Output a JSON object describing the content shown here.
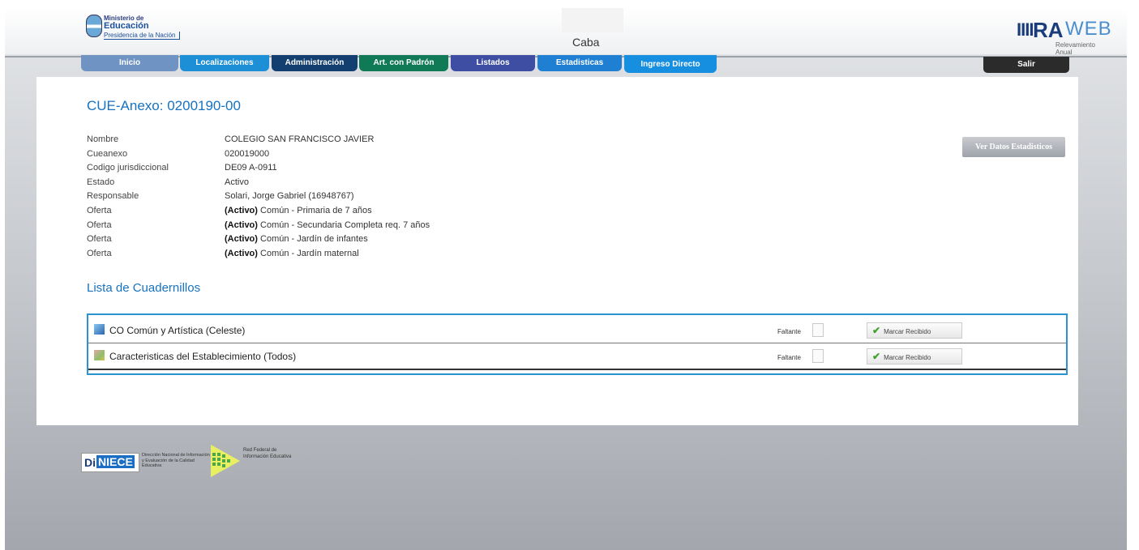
{
  "header": {
    "ministerio_l1": "Ministerio de",
    "ministerio_l2": "Educación",
    "ministerio_l3": "Presidencia de la Nación",
    "province": "Caba",
    "brand_bars": "IIII",
    "brand_ra": "RA",
    "brand_web": "WEB",
    "brand_sub": "Relevamiento Anual"
  },
  "nav": {
    "tabs": [
      "Inicio",
      "Localizaciones",
      "Administración",
      "Art. con Padrón",
      "Listados",
      "Estadisticas",
      "Ingreso Directo"
    ],
    "salir": "Salir"
  },
  "main": {
    "cue_title": "CUE-Anexo: 0200190-00",
    "ver_button": "Ver Datos Estadisticos",
    "info": [
      {
        "label": "Nombre",
        "prefix": "",
        "value": "COLEGIO SAN FRANCISCO JAVIER"
      },
      {
        "label": "Cueanexo",
        "prefix": "",
        "value": "020019000"
      },
      {
        "label": "Codigo jurisdiccional",
        "prefix": "",
        "value": "DE09 A-0911"
      },
      {
        "label": "Estado",
        "prefix": "",
        "value": "Activo"
      },
      {
        "label": "Responsable",
        "prefix": "",
        "value": "Solari, Jorge Gabriel (16948767)"
      },
      {
        "label": "Oferta",
        "prefix": "(Activo)",
        "value": " Común - Primaria de 7 años"
      },
      {
        "label": "Oferta",
        "prefix": "(Activo)",
        "value": " Común - Secundaria Completa req. 7 años"
      },
      {
        "label": "Oferta",
        "prefix": "(Activo)",
        "value": " Común - Jardín de infantes"
      },
      {
        "label": "Oferta",
        "prefix": "(Activo)",
        "value": " Común - Jardín maternal"
      }
    ],
    "lista_title": "Lista de Cuadernillos",
    "cuadernillos": [
      {
        "name": "CO Común y Artística (Celeste)",
        "status": "Faltante",
        "action": "Marcar Recibido"
      },
      {
        "name": "Caracteristicas del Establecimiento (Todos)",
        "status": "Faltante",
        "action": "Marcar Recibido"
      }
    ]
  },
  "footer": {
    "diniece_di": "Di",
    "diniece_niece": "NIECE",
    "diniece_text": "Dirección Nacional de Información y Evaluación de la Calidad Educativa",
    "red_text": "Red Federal de Información Educativa"
  },
  "colors": {
    "accent": "#1772c0",
    "table_border": "#2b93d1",
    "check_green": "#3fa02b"
  }
}
